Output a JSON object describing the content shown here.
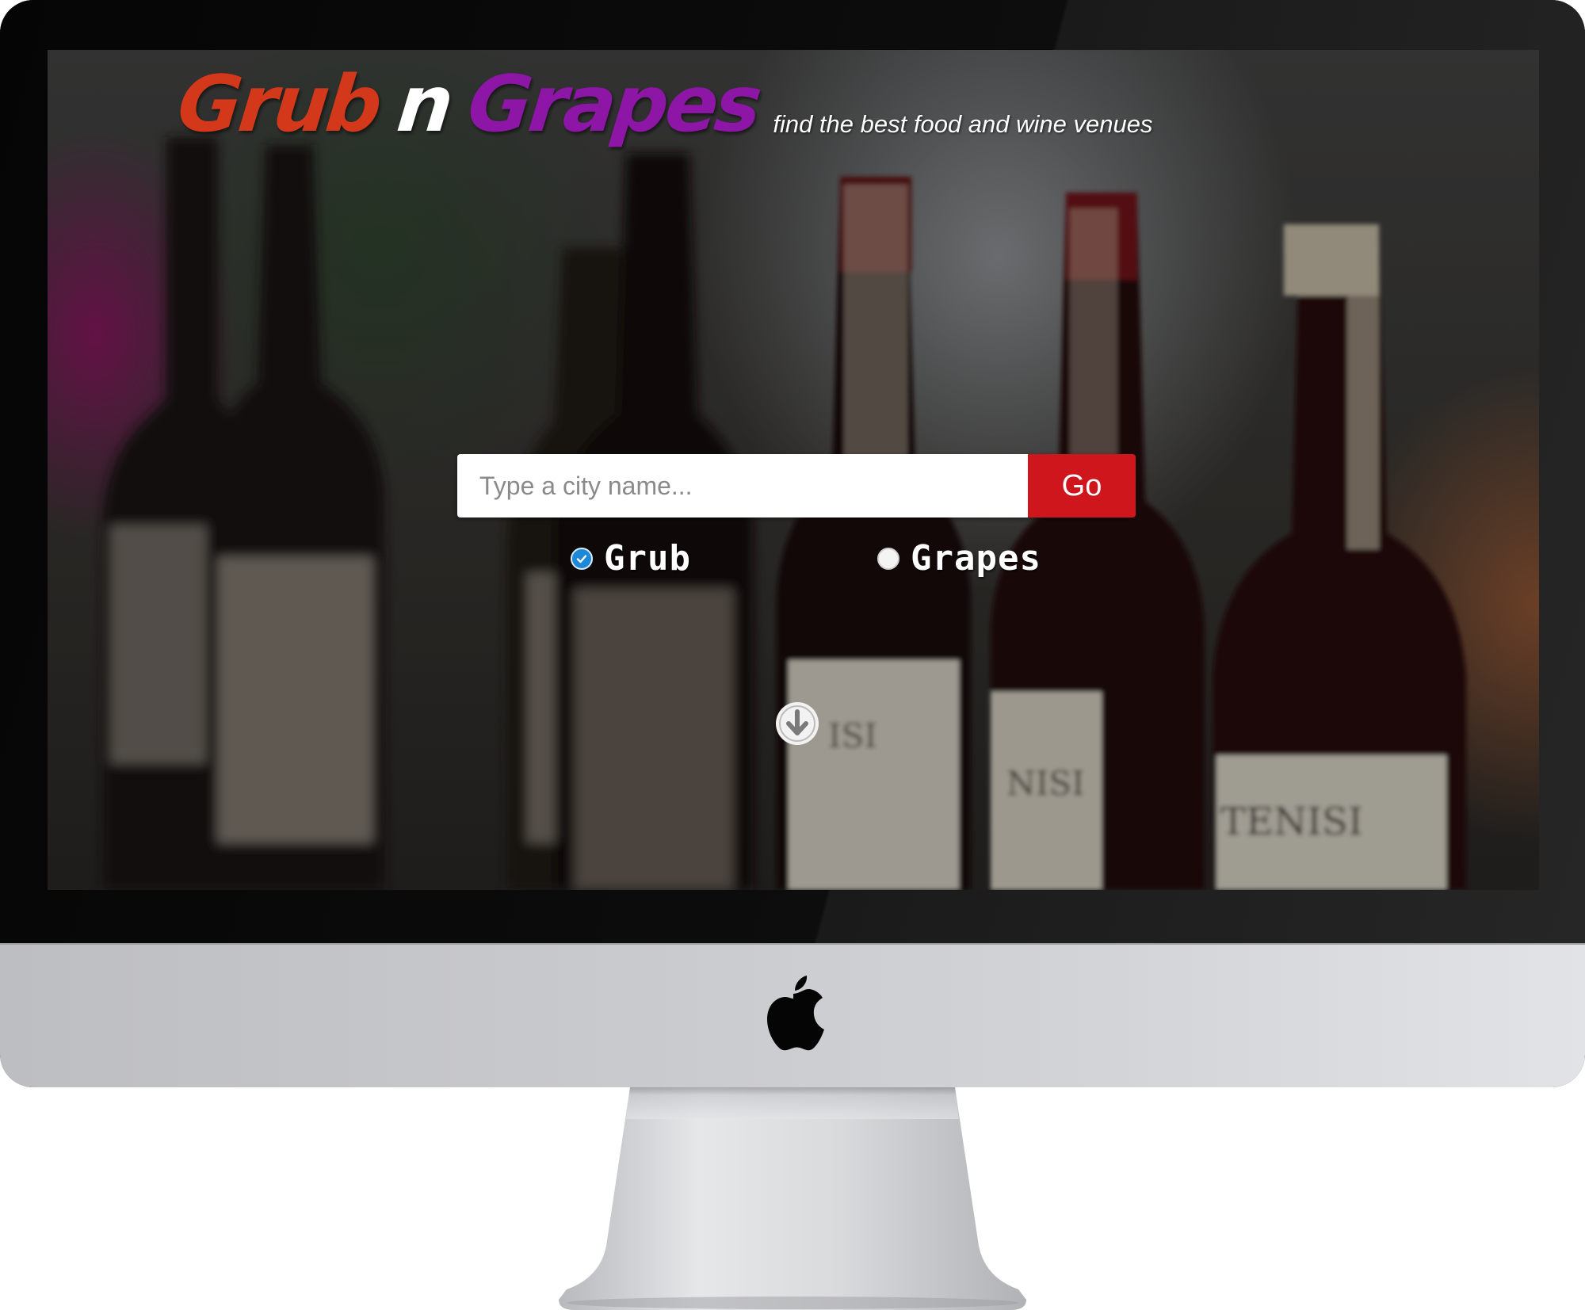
{
  "brand": {
    "word1": "Grub",
    "word2": "n",
    "word3": "Grapes",
    "tagline": "find the best food and wine venues",
    "colors": {
      "grub": "#d4381a",
      "n": "#ffffff",
      "grapes": "#8d16a6"
    }
  },
  "search": {
    "placeholder": "Type a city name...",
    "value": "",
    "go_label": "Go",
    "go_color": "#d0161d"
  },
  "options": {
    "grub": {
      "label": "Grub",
      "checked": true
    },
    "grapes": {
      "label": "Grapes",
      "checked": false
    }
  },
  "icons": {
    "scroll": "arrow-down-circle-icon",
    "device_logo": "apple-logo-icon"
  }
}
